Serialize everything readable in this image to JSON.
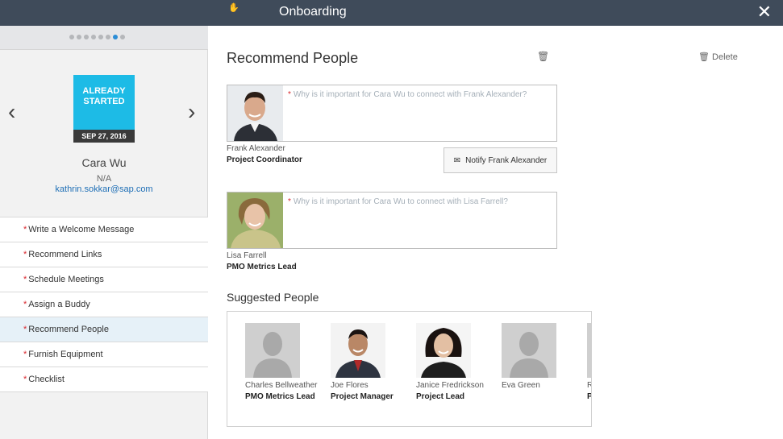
{
  "header": {
    "title": "Onboarding",
    "close_icon": "close-icon"
  },
  "sidebar": {
    "dots_total": 8,
    "dots_active": 7,
    "profile": {
      "status": "ALREADY STARTED",
      "status_line1": "ALREADY",
      "status_line2": "STARTED",
      "date": "SEP 27, 2016",
      "name": "Cara Wu",
      "title": "N/A",
      "email": "kathrin.sokkar@sap.com"
    },
    "tasks": [
      {
        "label": "Write a Welcome Message",
        "required": true
      },
      {
        "label": "Recommend Links",
        "required": true
      },
      {
        "label": "Schedule Meetings",
        "required": true
      },
      {
        "label": "Assign a Buddy",
        "required": true
      },
      {
        "label": "Recommend People",
        "required": true,
        "selected": true
      },
      {
        "label": "Furnish Equipment",
        "required": true
      },
      {
        "label": "Checklist",
        "required": true
      }
    ]
  },
  "main": {
    "title": "Recommend People",
    "delete_label": "Delete",
    "recommendations": [
      {
        "placeholder": "Why is it important for Cara Wu to connect with Frank Alexander?",
        "name": "Frank Alexander",
        "role": "Project Coordinator",
        "notify_label": "Notify Frank Alexander"
      },
      {
        "placeholder": "Why is it important for Cara Wu to connect with Lisa Farrell?",
        "name": "Lisa Farrell",
        "role": "PMO Metrics Lead"
      }
    ],
    "suggested_title": "Suggested People",
    "suggested": [
      {
        "name": "Charles Bellweather",
        "role": "PMO Metrics Lead",
        "photo": "placeholder"
      },
      {
        "name": "Joe Flores",
        "role": "Project Manager",
        "photo": "man"
      },
      {
        "name": "Janice Fredrickson",
        "role": "Project Lead",
        "photo": "woman"
      },
      {
        "name": "Eva Green",
        "role": "",
        "photo": "placeholder"
      },
      {
        "name": "R",
        "role": "P",
        "photo": "placeholder"
      }
    ]
  },
  "colors": {
    "header": "#3f4b5a",
    "accent": "#1dbbe6",
    "required": "#d9262c",
    "link": "#1f6fb6"
  }
}
